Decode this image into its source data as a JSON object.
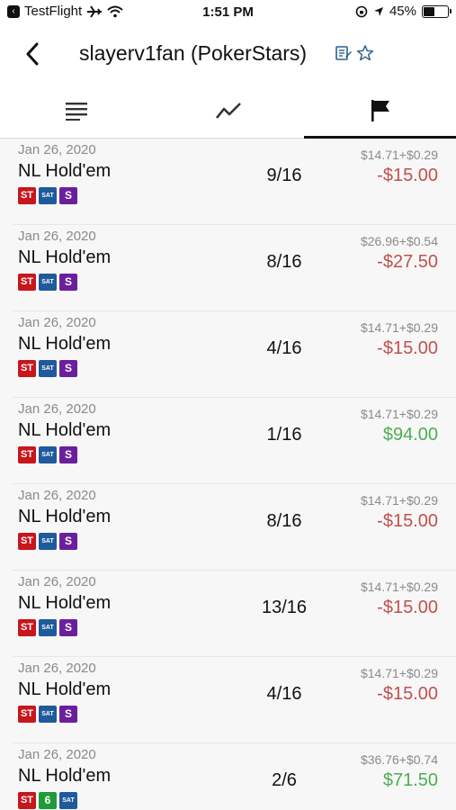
{
  "status_bar": {
    "back_app": "TestFlight",
    "time": "1:51 PM",
    "battery_percent": "45%",
    "battery_level": 0.45
  },
  "header": {
    "title": "slayerv1fan (PokerStars)"
  },
  "tabs": [
    {
      "name": "list",
      "icon": "list-icon",
      "active": false
    },
    {
      "name": "graph",
      "icon": "chart-line-icon",
      "active": false
    },
    {
      "name": "flag",
      "icon": "flag-icon",
      "active": true
    }
  ],
  "colors": {
    "loss": "#c0504d",
    "win": "#4caf50",
    "badge_st": "#c8161d",
    "badge_sat": "#1f5a9c",
    "badge_s": "#6a1f9c",
    "badge_6": "#1f9c3a"
  },
  "tournaments": [
    {
      "date": "Jan 26, 2020",
      "game": "NL Hold'em",
      "badges": [
        "ST",
        "SAT",
        "S"
      ],
      "position": "9/16",
      "buyin": "$14.71+$0.29",
      "result": "-$15.00",
      "outcome": "loss"
    },
    {
      "date": "Jan 26, 2020",
      "game": "NL Hold'em",
      "badges": [
        "ST",
        "SAT",
        "S"
      ],
      "position": "8/16",
      "buyin": "$26.96+$0.54",
      "result": "-$27.50",
      "outcome": "loss"
    },
    {
      "date": "Jan 26, 2020",
      "game": "NL Hold'em",
      "badges": [
        "ST",
        "SAT",
        "S"
      ],
      "position": "4/16",
      "buyin": "$14.71+$0.29",
      "result": "-$15.00",
      "outcome": "loss"
    },
    {
      "date": "Jan 26, 2020",
      "game": "NL Hold'em",
      "badges": [
        "ST",
        "SAT",
        "S"
      ],
      "position": "1/16",
      "buyin": "$14.71+$0.29",
      "result": "$94.00",
      "outcome": "win"
    },
    {
      "date": "Jan 26, 2020",
      "game": "NL Hold'em",
      "badges": [
        "ST",
        "SAT",
        "S"
      ],
      "position": "8/16",
      "buyin": "$14.71+$0.29",
      "result": "-$15.00",
      "outcome": "loss"
    },
    {
      "date": "Jan 26, 2020",
      "game": "NL Hold'em",
      "badges": [
        "ST",
        "SAT",
        "S"
      ],
      "position": "13/16",
      "buyin": "$14.71+$0.29",
      "result": "-$15.00",
      "outcome": "loss"
    },
    {
      "date": "Jan 26, 2020",
      "game": "NL Hold'em",
      "badges": [
        "ST",
        "SAT",
        "S"
      ],
      "position": "4/16",
      "buyin": "$14.71+$0.29",
      "result": "-$15.00",
      "outcome": "loss"
    },
    {
      "date": "Jan 26, 2020",
      "game": "NL Hold'em",
      "badges": [
        "ST",
        "6",
        "SAT"
      ],
      "position": "2/6",
      "buyin": "$36.76+$0.74",
      "result": "$71.50",
      "outcome": "win"
    }
  ]
}
